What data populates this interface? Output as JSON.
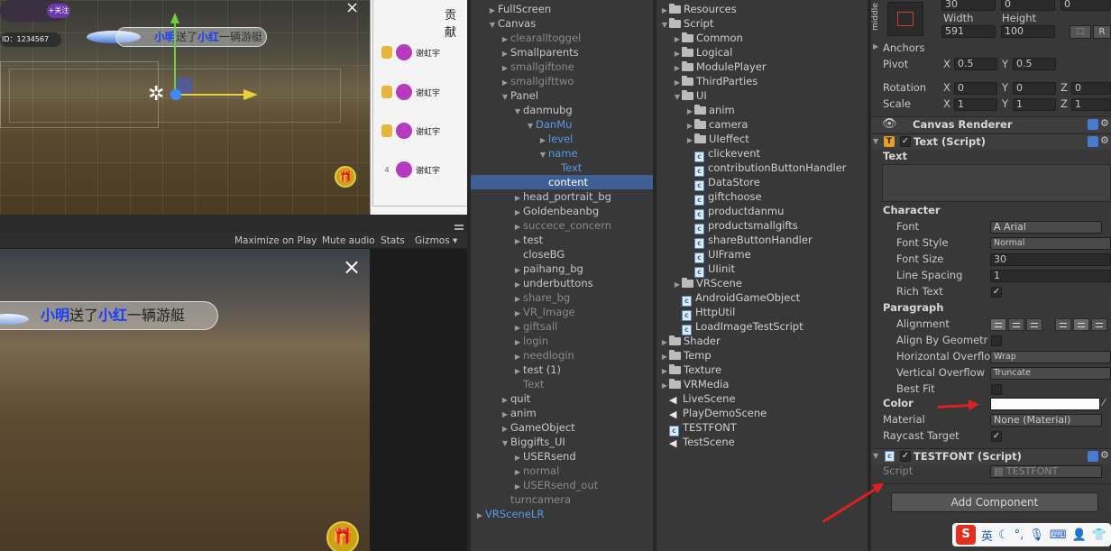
{
  "scene": {
    "follow_label": "+关注",
    "id_text": "ID：1234567",
    "message": {
      "sender": "小明",
      "verb": "送了",
      "receiver": "小红",
      "rest": "一辆游艇"
    },
    "close_icon": "×",
    "gift_icon": "gift-icon"
  },
  "rank": {
    "title": "贡献",
    "rows": [
      {
        "name": "谢虹宇",
        "medal": true
      },
      {
        "name": "谢虹宇",
        "medal": true
      },
      {
        "name": "谢虹宇",
        "medal": true
      },
      {
        "name": "谢虹宇",
        "rank": "4"
      }
    ]
  },
  "game_toolbar": {
    "maximize": "Maximize on Play",
    "mute": "Mute audio",
    "stats": "Stats",
    "gizmos": "Gizmos ▾"
  },
  "game": {
    "message": {
      "sender": "小明",
      "verb": "送了",
      "receiver": "小红",
      "rest": "一辆游艇"
    }
  },
  "hierarchy": [
    {
      "label": "FullScreen",
      "indent": 1,
      "arrow": "▶",
      "style": ""
    },
    {
      "label": "Canvas",
      "indent": 1,
      "arrow": "▼",
      "style": ""
    },
    {
      "label": "clearalltoggel",
      "indent": 2,
      "arrow": "▶",
      "style": "dim"
    },
    {
      "label": "Smallparents",
      "indent": 2,
      "arrow": "▶",
      "style": ""
    },
    {
      "label": "smallgiftone",
      "indent": 2,
      "arrow": "▶",
      "style": "dim"
    },
    {
      "label": "smallgifttwo",
      "indent": 2,
      "arrow": "▶",
      "style": "dim"
    },
    {
      "label": "Panel",
      "indent": 2,
      "arrow": "▼",
      "style": ""
    },
    {
      "label": "danmubg",
      "indent": 3,
      "arrow": "▼",
      "style": ""
    },
    {
      "label": "DanMu",
      "indent": 4,
      "arrow": "▼",
      "style": "blue"
    },
    {
      "label": "level",
      "indent": 5,
      "arrow": "▶",
      "style": "blue"
    },
    {
      "label": "name",
      "indent": 5,
      "arrow": "▼",
      "style": "blue"
    },
    {
      "label": "Text",
      "indent": 6,
      "arrow": "",
      "style": "blue"
    },
    {
      "label": "content",
      "indent": 5,
      "arrow": "",
      "style": "sel"
    },
    {
      "label": "head_portrait_bg",
      "indent": 3,
      "arrow": "▶",
      "style": ""
    },
    {
      "label": "Goldenbeanbg",
      "indent": 3,
      "arrow": "▶",
      "style": ""
    },
    {
      "label": "succece_concern",
      "indent": 3,
      "arrow": "▶",
      "style": "dim"
    },
    {
      "label": "test",
      "indent": 3,
      "arrow": "▶",
      "style": ""
    },
    {
      "label": "closeBG",
      "indent": 3,
      "arrow": "",
      "style": ""
    },
    {
      "label": "paihang_bg",
      "indent": 3,
      "arrow": "▶",
      "style": ""
    },
    {
      "label": "underbuttons",
      "indent": 3,
      "arrow": "▶",
      "style": ""
    },
    {
      "label": "share_bg",
      "indent": 3,
      "arrow": "▶",
      "style": "dim"
    },
    {
      "label": "VR_Image",
      "indent": 3,
      "arrow": "▶",
      "style": "dim"
    },
    {
      "label": "giftsall",
      "indent": 3,
      "arrow": "▶",
      "style": "dim"
    },
    {
      "label": "login",
      "indent": 3,
      "arrow": "▶",
      "style": "dim"
    },
    {
      "label": "needlogin",
      "indent": 3,
      "arrow": "▶",
      "style": "dim"
    },
    {
      "label": "test (1)",
      "indent": 3,
      "arrow": "▶",
      "style": ""
    },
    {
      "label": "Text",
      "indent": 3,
      "arrow": "",
      "style": "dim"
    },
    {
      "label": "quit",
      "indent": 2,
      "arrow": "▶",
      "style": ""
    },
    {
      "label": "anim",
      "indent": 2,
      "arrow": "▶",
      "style": ""
    },
    {
      "label": "GameObject",
      "indent": 2,
      "arrow": "▶",
      "style": ""
    },
    {
      "label": "Biggifts_UI",
      "indent": 2,
      "arrow": "▼",
      "style": ""
    },
    {
      "label": "USERsend",
      "indent": 3,
      "arrow": "▶",
      "style": ""
    },
    {
      "label": "normal",
      "indent": 3,
      "arrow": "▶",
      "style": "dim"
    },
    {
      "label": "USERsend_out",
      "indent": 3,
      "arrow": "▶",
      "style": "dim"
    },
    {
      "label": "turncamera",
      "indent": 2,
      "arrow": "",
      "style": "dim"
    },
    {
      "label": "VRSceneLR",
      "indent": 0,
      "arrow": "▶",
      "style": "blue"
    }
  ],
  "project": [
    {
      "label": "Resources",
      "indent": 0,
      "arrow": "▶",
      "icon": "folder"
    },
    {
      "label": "Script",
      "indent": 0,
      "arrow": "▼",
      "icon": "folder"
    },
    {
      "label": "Common",
      "indent": 1,
      "arrow": "▶",
      "icon": "folder"
    },
    {
      "label": "Logical",
      "indent": 1,
      "arrow": "▶",
      "icon": "folder"
    },
    {
      "label": "ModulePlayer",
      "indent": 1,
      "arrow": "▶",
      "icon": "folder"
    },
    {
      "label": "ThirdParties",
      "indent": 1,
      "arrow": "▶",
      "icon": "folder"
    },
    {
      "label": "UI",
      "indent": 1,
      "arrow": "▼",
      "icon": "folder"
    },
    {
      "label": "anim",
      "indent": 2,
      "arrow": "▶",
      "icon": "folder"
    },
    {
      "label": "camera",
      "indent": 2,
      "arrow": "▶",
      "icon": "folder"
    },
    {
      "label": "UIeffect",
      "indent": 2,
      "arrow": "▶",
      "icon": "folder"
    },
    {
      "label": "clickevent",
      "indent": 2,
      "arrow": "",
      "icon": "cs"
    },
    {
      "label": "contributionButtonHandler",
      "indent": 2,
      "arrow": "",
      "icon": "cs"
    },
    {
      "label": "DataStore",
      "indent": 2,
      "arrow": "",
      "icon": "cs"
    },
    {
      "label": "giftchoose",
      "indent": 2,
      "arrow": "",
      "icon": "cs"
    },
    {
      "label": "productdanmu",
      "indent": 2,
      "arrow": "",
      "icon": "cs"
    },
    {
      "label": "productsmallgifts",
      "indent": 2,
      "arrow": "",
      "icon": "cs"
    },
    {
      "label": "shareButtonHandler",
      "indent": 2,
      "arrow": "",
      "icon": "cs"
    },
    {
      "label": "UIFrame",
      "indent": 2,
      "arrow": "",
      "icon": "cs"
    },
    {
      "label": "UIinit",
      "indent": 2,
      "arrow": "",
      "icon": "cs"
    },
    {
      "label": "VRScene",
      "indent": 1,
      "arrow": "▶",
      "icon": "folder"
    },
    {
      "label": "AndroidGameObject",
      "indent": 1,
      "arrow": "",
      "icon": "cs"
    },
    {
      "label": "HttpUtil",
      "indent": 1,
      "arrow": "",
      "icon": "cs"
    },
    {
      "label": "LoadImageTestScript",
      "indent": 1,
      "arrow": "",
      "icon": "cs"
    },
    {
      "label": "Shader",
      "indent": 0,
      "arrow": "▶",
      "icon": "folder"
    },
    {
      "label": "Temp",
      "indent": 0,
      "arrow": "▶",
      "icon": "folder"
    },
    {
      "label": "Texture",
      "indent": 0,
      "arrow": "▶",
      "icon": "folder"
    },
    {
      "label": "VRMedia",
      "indent": 0,
      "arrow": "▶",
      "icon": "folder"
    },
    {
      "label": "LiveScene",
      "indent": 0,
      "arrow": "",
      "icon": "unity"
    },
    {
      "label": "PlayDemoScene",
      "indent": 0,
      "arrow": "",
      "icon": "unity"
    },
    {
      "label": "TESTFONT",
      "indent": 0,
      "arrow": "",
      "icon": "cs"
    },
    {
      "label": "TestScene",
      "indent": 0,
      "arrow": "",
      "icon": "unity"
    }
  ],
  "inspector": {
    "anchor_label": "middle",
    "pos_z": "0",
    "pos_y": "0",
    "pos_x": "30",
    "width_label": "Width",
    "height_label": "Height",
    "width": "591",
    "height": "100",
    "r_button": "R",
    "anchors_label": "Anchors",
    "pivot_label": "Pivot",
    "pivot_x": "0.5",
    "pivot_y": "0.5",
    "rotation_label": "Rotation",
    "rot_x": "0",
    "rot_y": "0",
    "rot_z": "0",
    "scale_label": "Scale",
    "scale_x": "1",
    "scale_y": "1",
    "scale_z": "1",
    "axis_x": "X",
    "axis_y": "Y",
    "axis_z": "Z",
    "canvas_renderer": "Canvas Renderer",
    "text_script": "Text (Script)",
    "text_label": "Text",
    "character": "Character",
    "font_label": "Font",
    "font_value": "Arial",
    "font_style_label": "Font Style",
    "font_style_value": "Normal",
    "font_size_label": "Font Size",
    "font_size_value": "30",
    "line_spacing_label": "Line Spacing",
    "line_spacing_value": "1",
    "rich_text_label": "Rich Text",
    "paragraph": "Paragraph",
    "alignment_label": "Alignment",
    "align_by_geometry_label": "Align By Geometr",
    "h_overflow_label": "Horizontal Overflo",
    "h_overflow_value": "Wrap",
    "v_overflow_label": "Vertical Overflow",
    "v_overflow_value": "Truncate",
    "best_fit_label": "Best Fit",
    "color_label": "Color",
    "color_value": "#ffffff",
    "material_label": "Material",
    "material_value": "None (Material)",
    "raycast_label": "Raycast Target",
    "testfont_script": "TESTFONT (Script)",
    "script_label": "Script",
    "script_value": "TESTFONT",
    "add_component": "Add Component",
    "ime_label": "英"
  }
}
